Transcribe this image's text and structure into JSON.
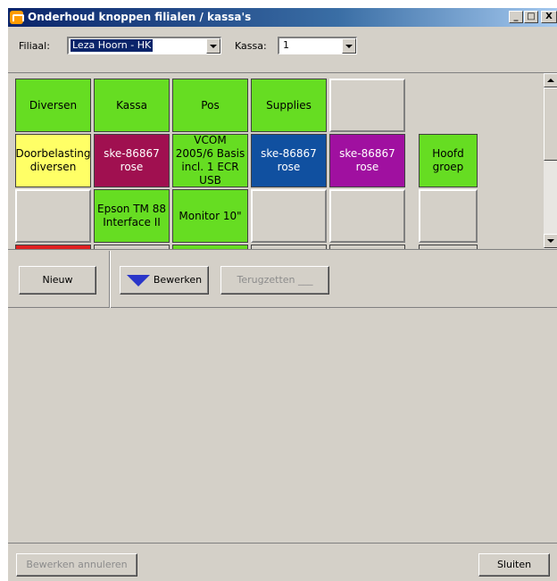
{
  "window": {
    "title": "Onderhoud knoppen filialen / kassa's",
    "buttons": {
      "minimize": "_",
      "maximize": "□",
      "close": "X"
    }
  },
  "filters": {
    "filiaal_label": "Filiaal:",
    "filiaal_value": "Leza Hoorn  - HK",
    "kassa_label": "Kassa:",
    "kassa_value": "1"
  },
  "grid": {
    "rows": [
      [
        {
          "label": "Diversen",
          "color": "#66dd22"
        },
        {
          "label": "Kassa",
          "color": "#66dd22"
        },
        {
          "label": "Pos",
          "color": "#66dd22"
        },
        {
          "label": "Supplies",
          "color": "#66dd22"
        },
        {
          "label": "",
          "color": "#d4d0c8"
        }
      ],
      [
        {
          "label": "Doorbelasting diversen",
          "color": "#ffff66"
        },
        {
          "label": "ske-86867 rose",
          "color": "#a01050"
        },
        {
          "label": "VCOM 2005/6 Basis incl. 1 ECR USB",
          "color": "#66dd22"
        },
        {
          "label": "ske-86867 rose",
          "color": "#1050a0"
        },
        {
          "label": "ske-86867 rose",
          "color": "#a010a0"
        },
        {
          "label": "Hoofd groep",
          "color": "#66dd22"
        }
      ],
      [
        {
          "label": "",
          "color": "#d4d0c8"
        },
        {
          "label": "Epson TM 88 Interface II",
          "color": "#66dd22"
        },
        {
          "label": "Monitor 10\"",
          "color": "#66dd22"
        },
        {
          "label": "",
          "color": "#d4d0c8"
        },
        {
          "label": "",
          "color": "#d4d0c8"
        },
        {
          "label": "",
          "color": "#d4d0c8"
        }
      ]
    ]
  },
  "toolbar": {
    "new_label": "Nieuw",
    "edit_label": "Bewerken",
    "reset_label": "Terugzetten ___"
  },
  "footer": {
    "cancel_edit_label": "Bewerken annuleren",
    "close_label": "Sluiten"
  }
}
